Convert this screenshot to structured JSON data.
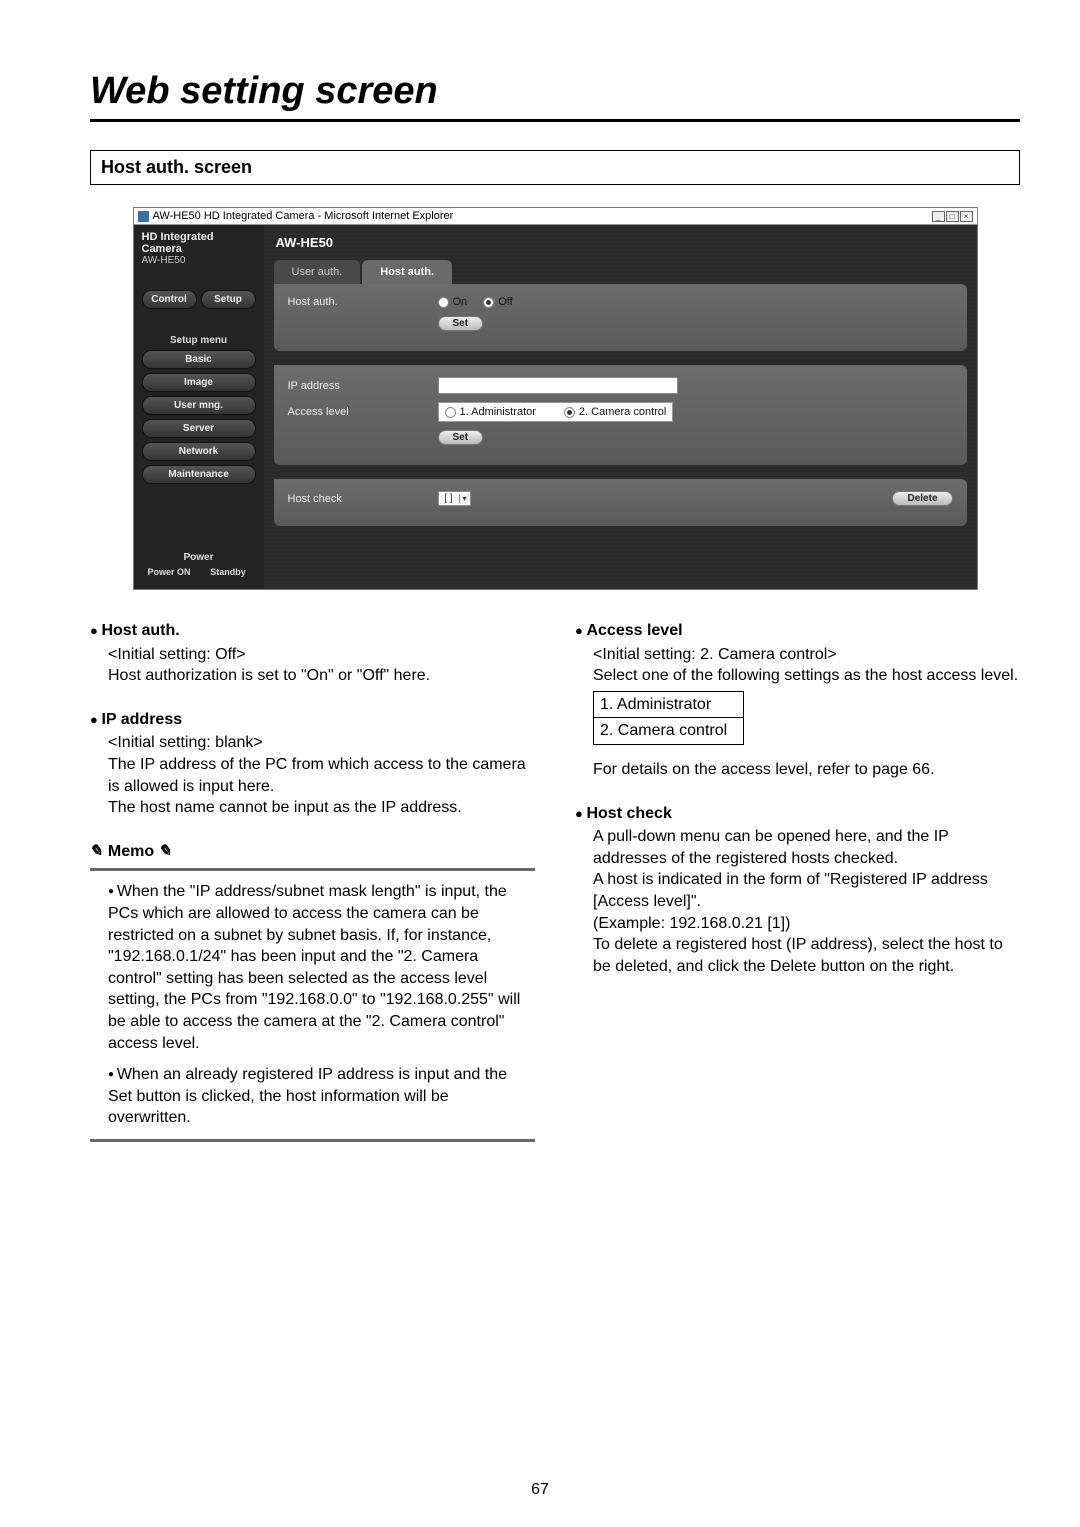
{
  "page": {
    "title": "Web setting screen",
    "section_header": "Host auth. screen",
    "number": "67"
  },
  "browser": {
    "title": "AW-HE50 HD Integrated Camera - Microsoft Internet Explorer",
    "header_line1": "HD Integrated Camera",
    "header_line2": "AW-HE50",
    "model": "AW-HE50",
    "side": {
      "control": "Control",
      "setup": "Setup",
      "setup_menu": "Setup menu",
      "basic": "Basic",
      "image": "Image",
      "user_mng": "User mng.",
      "server": "Server",
      "network": "Network",
      "maintenance": "Maintenance",
      "power": "Power",
      "power_on": "Power ON",
      "standby": "Standby"
    },
    "tabs": {
      "user_auth": "User auth.",
      "host_auth": "Host auth."
    },
    "form": {
      "host_auth_label": "Host auth.",
      "on": "On",
      "off": "Off",
      "set": "Set",
      "ip_label": "IP address",
      "access_label": "Access level",
      "admin": "1. Administrator",
      "camctrl": "2. Camera control",
      "host_check_label": "Host check",
      "dd_value": "[ ]",
      "delete": "Delete"
    }
  },
  "left": {
    "h_host_auth": "Host auth.",
    "host_auth_init": "<Initial setting: Off>",
    "host_auth_body": "Host authorization is set to \"On\" or \"Off\" here.",
    "h_ip": "IP address",
    "ip_init": "<Initial setting: blank>",
    "ip_body1": "The IP address of the PC from which access to the camera is allowed is input here.",
    "ip_body2": "The host name cannot be input as the IP address.",
    "memo_label": "Memo",
    "memo1": "When the \"IP address/subnet mask length\" is input, the PCs which are allowed to access the camera can be restricted on a subnet by subnet basis. If, for instance, \"192.168.0.1/24\" has been input and the \"2. Camera control\" setting has been selected as the access level setting, the PCs from \"192.168.0.0\" to \"192.168.0.255\" will be able to access the camera at the \"2. Camera control\" access level.",
    "memo2": "When an already registered IP address is input and the Set button is clicked, the host information will be overwritten."
  },
  "right": {
    "h_access": "Access level",
    "access_init": "<Initial setting: 2. Camera control>",
    "access_body": "Select one of the following settings as the host access level.",
    "tbl1": "1. Administrator",
    "tbl2": "2. Camera control",
    "access_ref": "For details on the access level, refer to page 66.",
    "h_hostcheck": "Host check",
    "hc1": "A pull-down menu can be opened here, and the IP addresses of the registered hosts checked.",
    "hc2": "A host is indicated in the form of \"Registered IP address [Access level]\".",
    "hc3": "(Example: 192.168.0.21 [1])",
    "hc4": "To delete a registered host (IP address), select the host to be deleted, and click the Delete button on the right."
  }
}
